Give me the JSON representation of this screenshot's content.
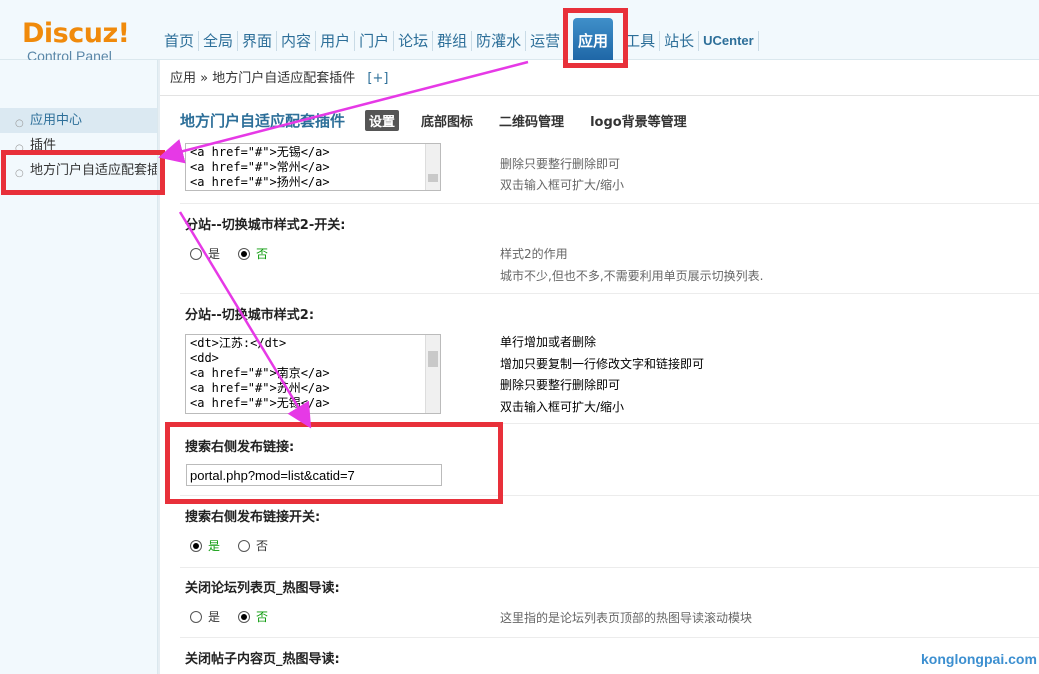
{
  "logo": {
    "title": "Discuz!",
    "subtitle": "Control Panel"
  },
  "topnav": {
    "items": [
      "首页",
      "全局",
      "界面",
      "内容",
      "用户",
      "门户",
      "论坛",
      "群组",
      "防灌水",
      "运营",
      "应用",
      "工具",
      "站长",
      "UCenter"
    ],
    "active": "应用",
    "operate_label": "运营",
    "tools_label": "工具",
    "admin_label": "站长",
    "ucenter_label": "UCenter"
  },
  "breadcrumb": {
    "root": "应用",
    "sep": "»",
    "current": "地方门户自适应配套插件",
    "add": "[+]"
  },
  "sidebar": {
    "items": [
      "应用中心",
      "插件",
      "地方门户自适应配套插件"
    ]
  },
  "subnav": {
    "title": "地方门户自适应配套插件",
    "tabs": [
      "设置",
      "底部图标",
      "二维码管理",
      "logo背景等管理"
    ],
    "active": "设置"
  },
  "settings": {
    "top_textarea_lines": [
      "<a href=\"#\">无锡</a>",
      "<a href=\"#\">常州</a>",
      "<a href=\"#\">扬州</a>"
    ],
    "top_tips": [
      "删除只要整行删除即可",
      "双击输入框可扩大/缩小"
    ],
    "switch2": {
      "label": "分站--切换城市样式2-开关:",
      "yes": "是",
      "no": "否",
      "value": "no",
      "tips": [
        "样式2的作用",
        "城市不少,但也不多,不需要利用单页展示切换列表."
      ]
    },
    "style2": {
      "label": "分站--切换城市样式2:",
      "lines": [
        "<dt>江苏:</dt>",
        "<dd>",
        "<a href=\"#\">南京</a>",
        "<a href=\"#\">苏州</a>",
        "<a href=\"#\">无锡</a>"
      ],
      "tips": [
        "单行增加或者删除",
        "增加只要复制一行修改文字和链接即可",
        "删除只要整行删除即可",
        "双击输入框可扩大/缩小"
      ]
    },
    "search_link": {
      "label": "搜索右侧发布链接:",
      "value": "portal.php?mod=list&catid=7"
    },
    "search_switch": {
      "label": "搜索右侧发布链接开关:",
      "yes": "是",
      "no": "否",
      "value": "yes"
    },
    "forum_hot": {
      "label": "关闭论坛列表页_热图导读:",
      "yes": "是",
      "no": "否",
      "value": "no",
      "tip": "这里指的是论坛列表页顶部的热图导读滚动模块"
    },
    "thread_hot": {
      "label": "关闭帖子内容页_热图导读:"
    }
  },
  "watermark": "konglongpai.com",
  "colors": {
    "accent": "#2d6f99",
    "highlight_box": "#e8303a",
    "arrow": "#e639e6",
    "logo": "#f08a0b"
  }
}
